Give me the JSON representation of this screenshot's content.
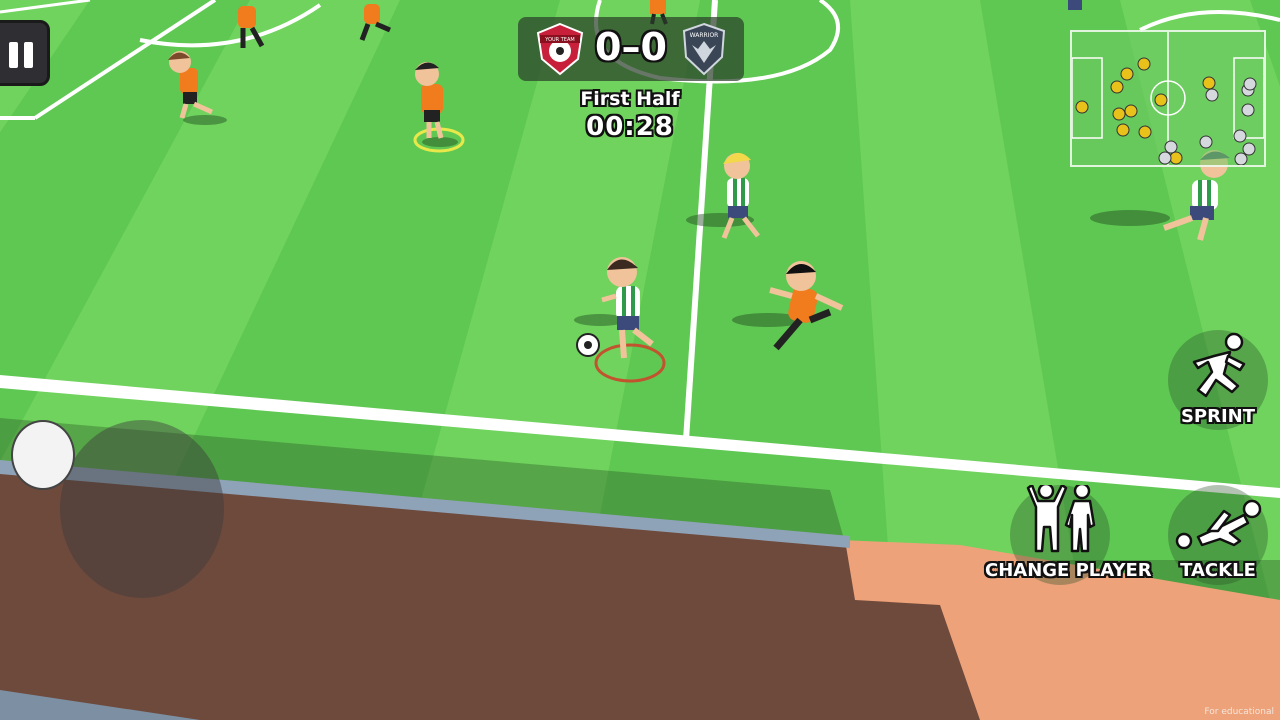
{
  "match": {
    "home_score": "0",
    "away_score": "0",
    "score_separator": "–",
    "period": "First Half",
    "clock": "00:28",
    "home_badge_text": "YOUR TEAM",
    "away_badge_text": "WARRIOR"
  },
  "controls": {
    "sprint_label": "SPRINT",
    "change_player_label": "CHANGE PLAYER",
    "tackle_label": "TACKLE"
  },
  "footer": {
    "watermark": "For educational"
  },
  "colors": {
    "pitch_light": "#6ccf58",
    "pitch_dark": "#58c04a",
    "home_kit": "#f07c1e",
    "away_kit": "#2e9a4a",
    "track": "#8a5a47",
    "track_light": "#eea27a"
  },
  "icons": [
    "pause-icon",
    "home-team-badge-icon",
    "away-team-badge-icon",
    "sprint-icon",
    "change-player-icon",
    "tackle-icon"
  ]
}
